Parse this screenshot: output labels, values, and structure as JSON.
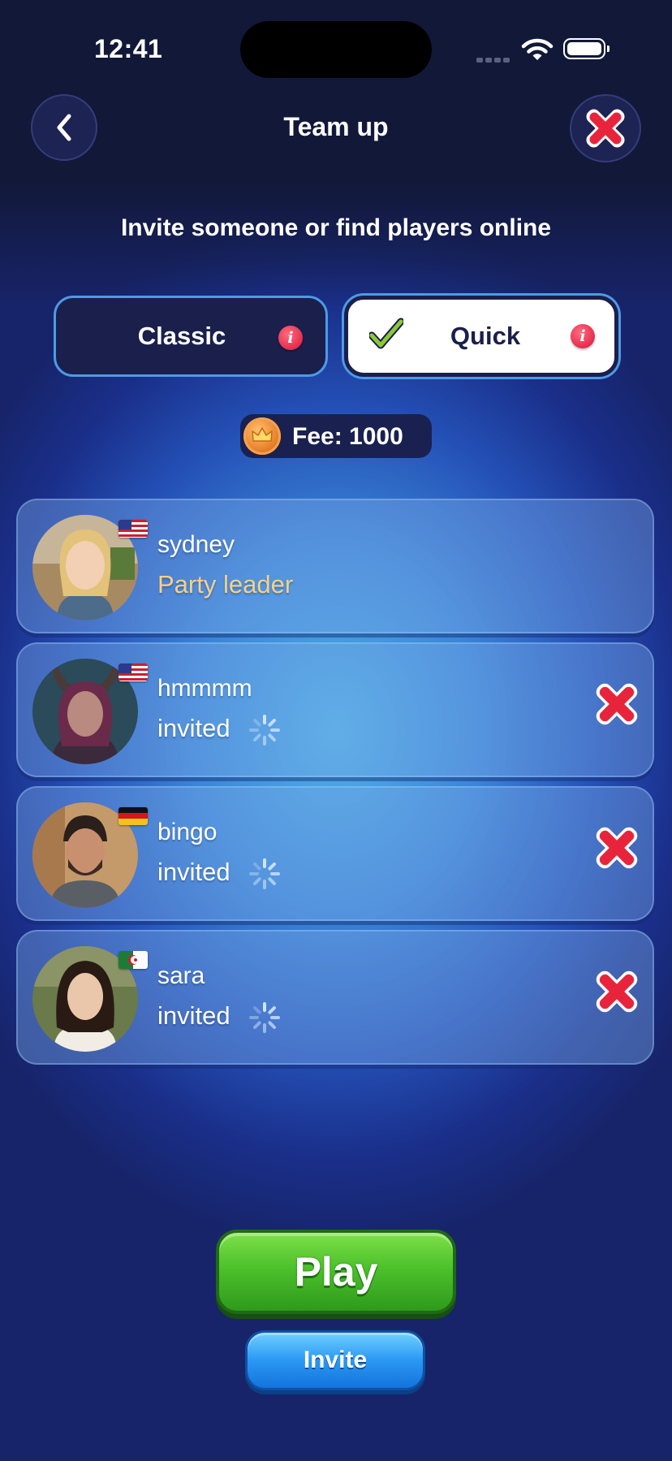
{
  "status_bar": {
    "time": "12:41"
  },
  "header": {
    "title": "Team up",
    "back_icon": "chevron-left-icon",
    "close_icon": "close-icon"
  },
  "subtitle": "Invite someone or find players online",
  "modes": [
    {
      "label": "Classic",
      "selected": false
    },
    {
      "label": "Quick",
      "selected": true
    }
  ],
  "fee": {
    "text": "Fee: 1000",
    "icon": "coin-crown-icon"
  },
  "players": [
    {
      "name": "sydney",
      "status": "Party leader",
      "flag": "us-flag",
      "removable": false
    },
    {
      "name": "hmmmm",
      "status": "invited",
      "flag": "us-flag",
      "removable": true
    },
    {
      "name": "bingo",
      "status": "invited",
      "flag": "de-flag",
      "removable": true
    },
    {
      "name": "sara",
      "status": "invited",
      "flag": "dz-flag",
      "removable": true
    }
  ],
  "buttons": {
    "play": "Play",
    "invite": "Invite"
  },
  "colors": {
    "play_green": "#4cc12b",
    "invite_blue": "#2a98f3",
    "remove_red": "#e8243c",
    "leader_gold": "#f6d08a",
    "header_navy": "#121838"
  }
}
